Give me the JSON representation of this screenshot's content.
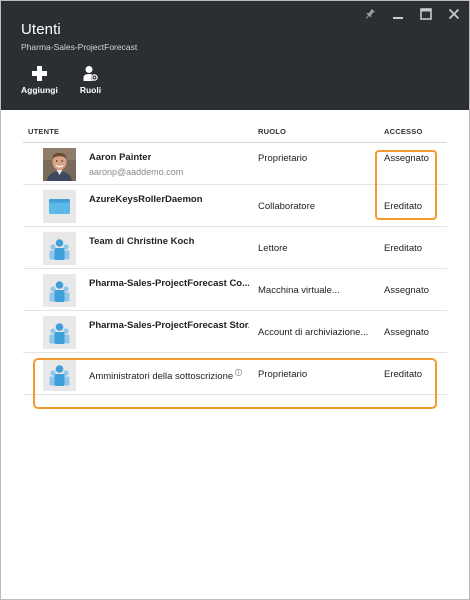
{
  "header": {
    "title": "Utenti",
    "subtitle": "Pharma-Sales-ProjectForecast",
    "commands": [
      {
        "label": "Aggiungi",
        "icon": "plus-icon"
      },
      {
        "label": "Ruoli",
        "icon": "roles-icon"
      }
    ],
    "window_controls": [
      "pin-icon",
      "minimize-icon",
      "maximize-icon",
      "close-icon"
    ]
  },
  "grid": {
    "columns": [
      "UTENTE",
      "RUOLO",
      "ACCESSO"
    ],
    "rows": [
      {
        "name": "Aaron Painter",
        "email": "aaronp@aaddemo.com",
        "role": "Proprietario",
        "access": "Assegnato",
        "avatar": "user-photo"
      },
      {
        "name": "AzureKeysRollerDaemon",
        "role": "Collaboratore",
        "access": "Ereditato",
        "avatar": "application-icon"
      },
      {
        "name": "Team di Christine Koch",
        "role": "Lettore",
        "access": "Ereditato",
        "avatar": "group-icon"
      },
      {
        "name": "Pharma-Sales-ProjectForecast Co...",
        "role": "Macchina virtuale...",
        "access": "Assegnato",
        "avatar": "group-icon"
      },
      {
        "name": "Pharma-Sales-ProjectForecast Stor...",
        "role": "Account di archiviazione...",
        "access": "Assegnato",
        "avatar": "group-icon"
      },
      {
        "name": "Amministratori della sottoscrizione",
        "role": "Proprietario",
        "access": "Ereditato",
        "avatar": "group-icon"
      }
    ]
  },
  "colors": {
    "header_bg": "#2b2e33",
    "highlight": "#f39a2f",
    "group_icon": "#3e9fd9"
  }
}
